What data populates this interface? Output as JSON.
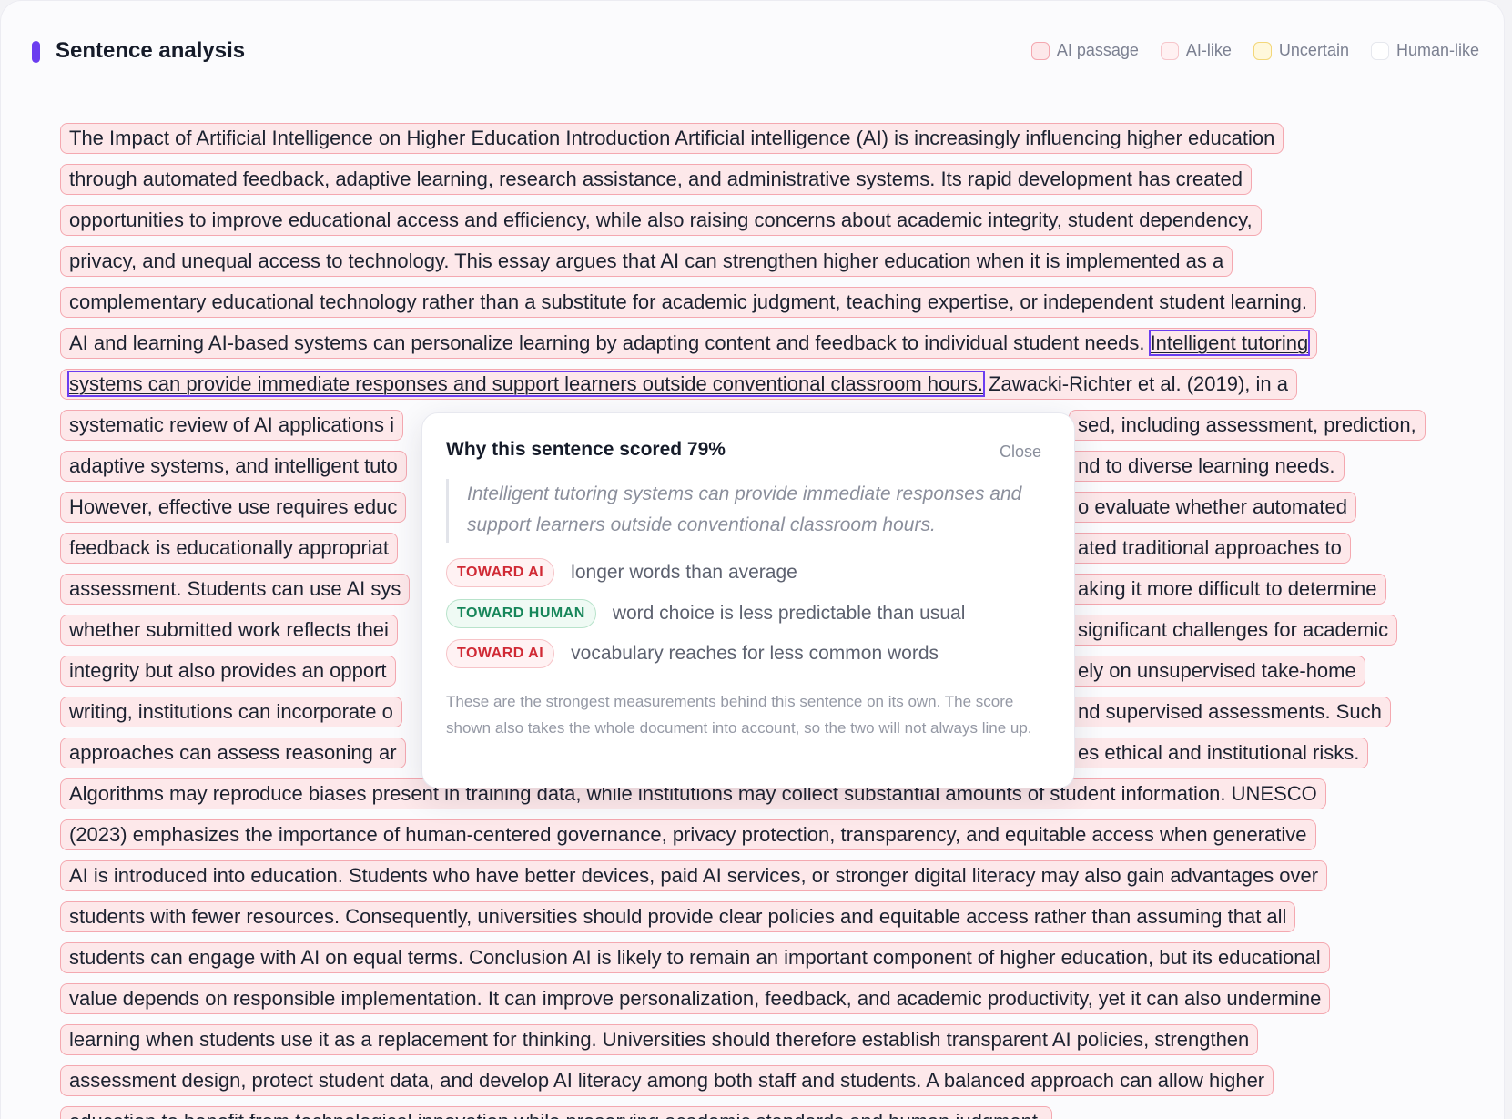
{
  "header": {
    "title": "Sentence analysis"
  },
  "legend": [
    {
      "label": "AI passage",
      "color": "#f4a8b0"
    },
    {
      "label": "AI-like",
      "color": "#f6c6cb"
    },
    {
      "label": "Uncertain",
      "color": "#f3d77a"
    },
    {
      "label": "Human-like",
      "color": "#e6e8ee"
    }
  ],
  "document": {
    "lines": [
      "The Impact of Artificial Intelligence on Higher Education Introduction Artificial intelligence (AI) is increasingly influencing higher education",
      "through automated feedback, adaptive learning, research assistance, and administrative systems. Its rapid development has created",
      "opportunities to improve educational access and efficiency, while also raising concerns about academic integrity, student dependency,",
      "privacy, and unequal access to technology. This essay argues that AI can strengthen higher education when it is implemented as a",
      "complementary educational technology rather than a substitute for academic judgment, teaching expertise, or independent student learning.",
      "AI and learning AI-based systems can personalize learning by adapting content and feedback to individual student needs. ",
      "Intelligent tutoring",
      "systems can provide immediate responses and support learners outside conventional classroom hours.",
      " Zawacki-Richter et al. (2019), in a",
      "systematic review of AI applications i",
      "sed, including assessment, prediction,",
      "adaptive systems, and intelligent tuto",
      "nd to diverse learning needs.",
      "However, effective use requires educ",
      "o evaluate whether automated",
      "feedback is educationally appropriat",
      "ated traditional approaches to",
      "assessment. Students can use AI sys",
      "aking it more difficult to determine",
      "whether submitted work reflects thei",
      " significant challenges for academic",
      "integrity but also provides an opport",
      "ely on unsupervised take-home",
      "writing, institutions can incorporate o",
      "nd supervised assessments. Such",
      "approaches can assess reasoning ar",
      "es ethical and institutional risks.",
      "Algorithms may reproduce biases present in training data, while institutions may collect substantial amounts of student information. UNESCO",
      "(2023) emphasizes the importance of human-centered governance, privacy protection, transparency, and equitable access when generative",
      "AI is introduced into education. Students who have better devices, paid AI services, or stronger digital literacy may also gain advantages over",
      "students with fewer resources. Consequently, universities should provide clear policies and equitable access rather than assuming that all",
      "students can engage with AI on equal terms. Conclusion AI is likely to remain an important component of higher education, but its educational",
      "value depends on responsible implementation. It can improve personalization, feedback, and academic productivity, yet it can also undermine",
      "learning when students use it as a replacement for thinking. Universities should therefore establish transparent AI policies, strengthen",
      "assessment design, protect student data, and develop AI literacy among both staff and students. A balanced approach can allow higher",
      "education to benefit from technological innovation while preserving academic standards and human judgment."
    ]
  },
  "popover": {
    "title": "Why this sentence scored 79%",
    "close_label": "Close",
    "quote": "Intelligent tutoring systems can provide immediate responses and support learners outside conventional classroom hours.",
    "reasons": [
      {
        "tag": "TOWARD AI",
        "text": "longer words than average"
      },
      {
        "tag": "TOWARD HUMAN",
        "text": "word choice is less predictable than usual"
      },
      {
        "tag": "TOWARD AI",
        "text": "vocabulary reaches for less common words"
      }
    ],
    "note": "These are the strongest measurements behind this sentence on its own. The score shown also takes the whole document into account, so the two will not always line up."
  }
}
